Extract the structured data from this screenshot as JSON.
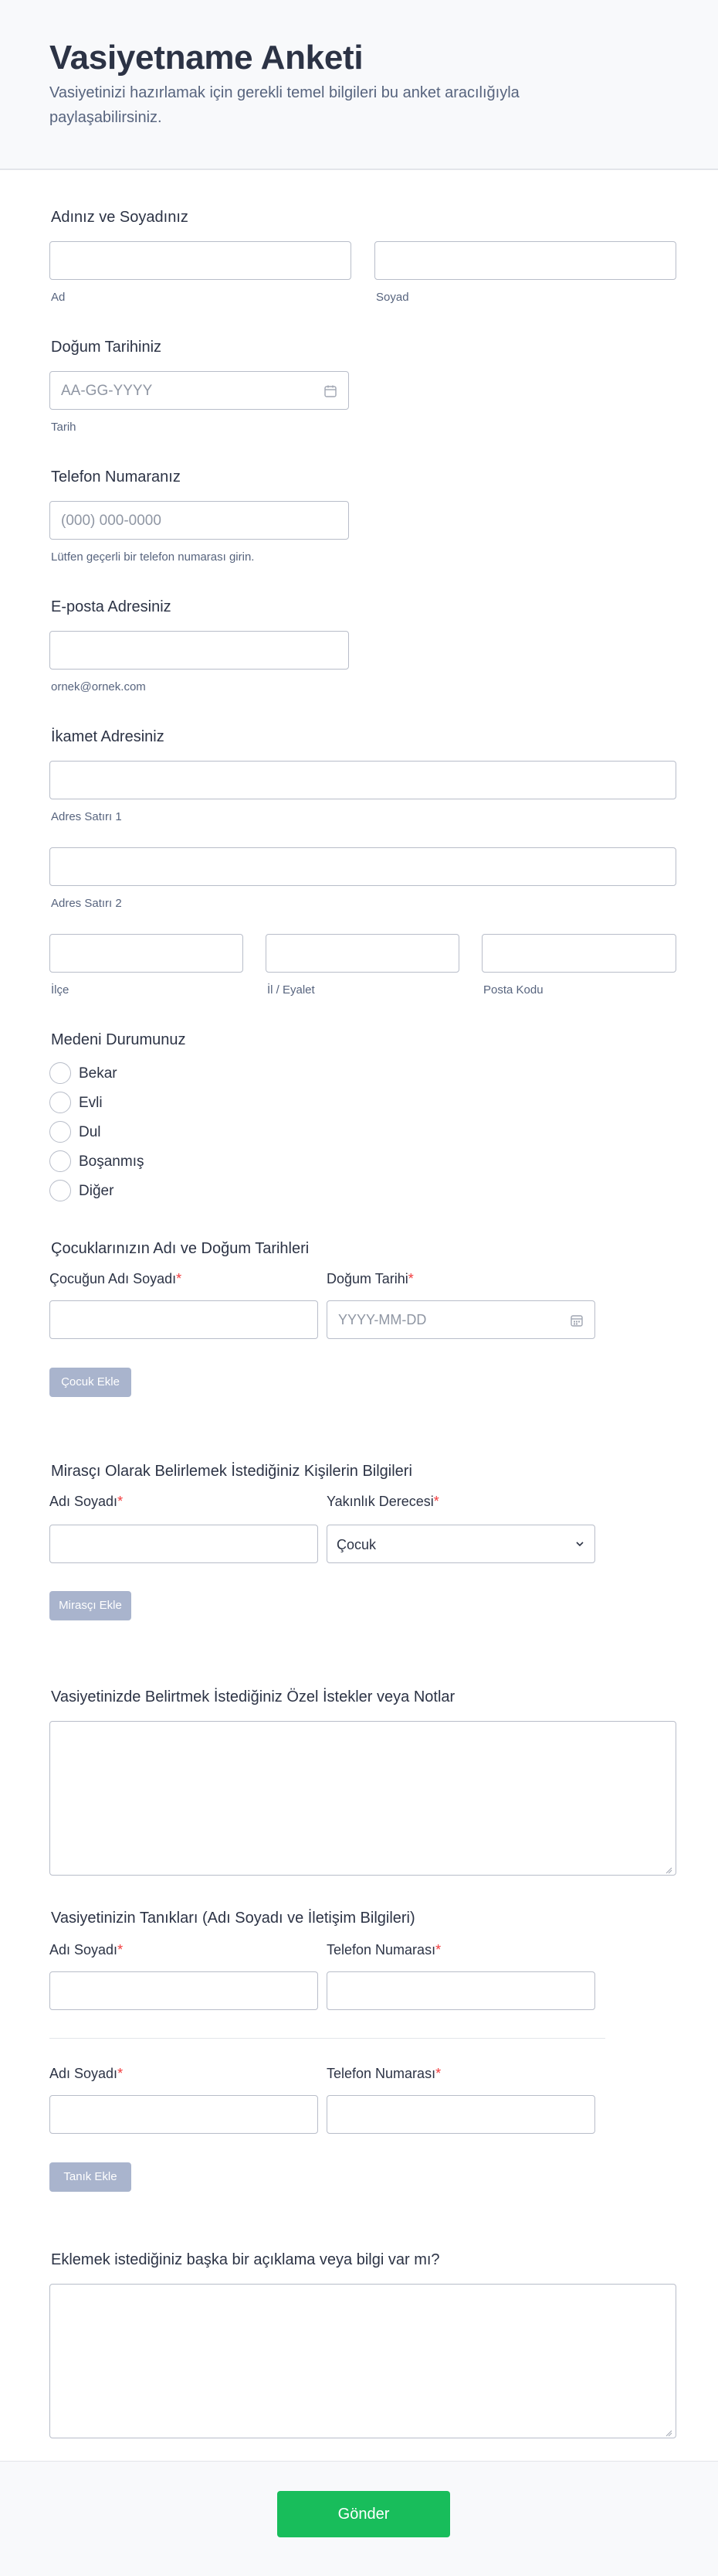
{
  "header": {
    "title": "Vasiyetname Anketi",
    "subtitle": "Vasiyetinizi hazırlamak için gerekli temel bilgileri bu anket aracılığıyla paylaşabilirsiniz."
  },
  "name": {
    "label": "Adınız ve Soyadınız",
    "first_sub": "Ad",
    "last_sub": "Soyad"
  },
  "birth": {
    "label": "Doğum Tarihiniz",
    "placeholder": "AA-GG-YYYY",
    "sub": "Tarih"
  },
  "phone": {
    "label": "Telefon Numaranız",
    "placeholder": "(000) 000-0000",
    "sub": "Lütfen geçerli bir telefon numarası girin."
  },
  "email": {
    "label": "E-posta Adresiniz",
    "sub": "ornek@ornek.com"
  },
  "address": {
    "label": "İkamet Adresiniz",
    "line1_sub": "Adres Satırı 1",
    "line2_sub": "Adres Satırı 2",
    "district_sub": "İlçe",
    "province_sub": "İl / Eyalet",
    "zip_sub": "Posta Kodu"
  },
  "marital": {
    "label": "Medeni Durumunuz",
    "options": [
      "Bekar",
      "Evli",
      "Dul",
      "Boşanmış",
      "Diğer"
    ]
  },
  "children": {
    "label": "Çocuklarınızın Adı ve Doğum Tarihleri",
    "col1": "Çocuğun Adı Soyadı",
    "col2": "Doğum Tarihi",
    "date_placeholder": "YYYY-MM-DD",
    "add_button": "Çocuk Ekle"
  },
  "heirs": {
    "label": "Mirasçı Olarak Belirlemek İstediğiniz Kişilerin Bilgileri",
    "col1": "Adı Soyadı",
    "col2": "Yakınlık Derecesi",
    "relation_value": "Çocuk",
    "add_button": "Mirasçı Ekle"
  },
  "notes": {
    "label": "Vasiyetinizde Belirtmek İstediğiniz Özel İstekler veya Notlar"
  },
  "witnesses": {
    "label": "Vasiyetinizin Tanıkları (Adı Soyadı ve İletişim Bilgileri)",
    "col1": "Adı Soyadı",
    "col2": "Telefon Numarası",
    "add_button": "Tanık Ekle"
  },
  "extra": {
    "label": "Eklemek istediğiniz başka bir açıklama veya bilgi var mı?"
  },
  "submit": {
    "label": "Gönder"
  },
  "required_mark": "*",
  "colors": {
    "submit": "#18bd5b",
    "add_button": "#a9b4cd",
    "required": "#f23a3c",
    "text": "#2c3345"
  }
}
